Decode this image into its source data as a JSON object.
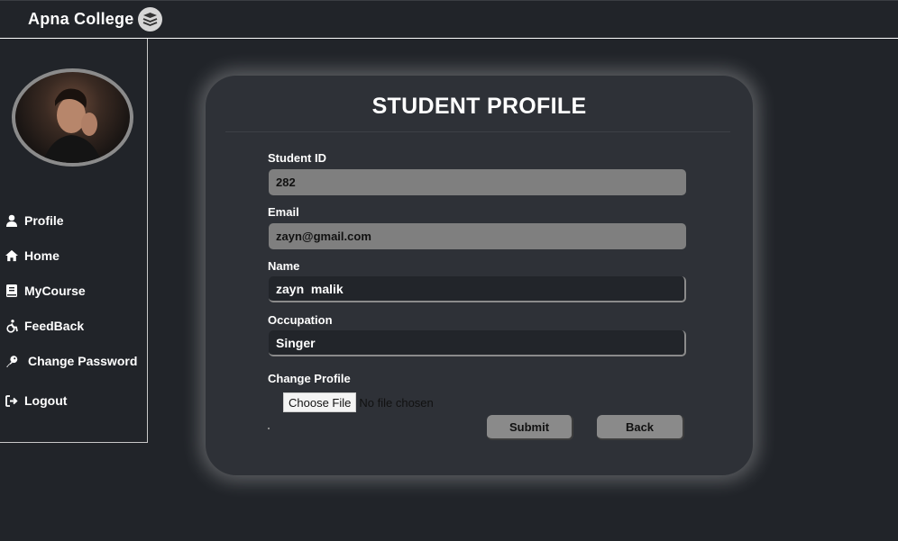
{
  "header": {
    "brand": "Apna College",
    "logo_icon": "stack-books-icon"
  },
  "sidebar": {
    "avatar_alt": "profile photo",
    "items": [
      {
        "label": "Profile",
        "icon": "user-icon"
      },
      {
        "label": "Home",
        "icon": "home-icon"
      },
      {
        "label": "MyCourse",
        "icon": "book-icon"
      },
      {
        "label": "FeedBack",
        "icon": "accessibility-icon"
      },
      {
        "label": "Change Password",
        "icon": "key-icon"
      },
      {
        "label": "Logout",
        "icon": "logout-icon"
      }
    ]
  },
  "card": {
    "title": "STUDENT PROFILE",
    "fields": {
      "student_id": {
        "label": "Student ID",
        "value": "282"
      },
      "email": {
        "label": "Email",
        "value": "zayn@gmail.com"
      },
      "name": {
        "label": "Name",
        "value": "zayn  malik"
      },
      "occupation": {
        "label": "Occupation",
        "value": "Singer"
      }
    },
    "change_profile": {
      "label": "Change Profile",
      "button": "Choose File",
      "status": "No file chosen"
    },
    "submit_label": "Submit",
    "back_label": "Back"
  },
  "colors": {
    "background": "#212429",
    "card": "#2e3137",
    "readonly_field": "#7f7f7f",
    "button": "#8a8a8a"
  }
}
